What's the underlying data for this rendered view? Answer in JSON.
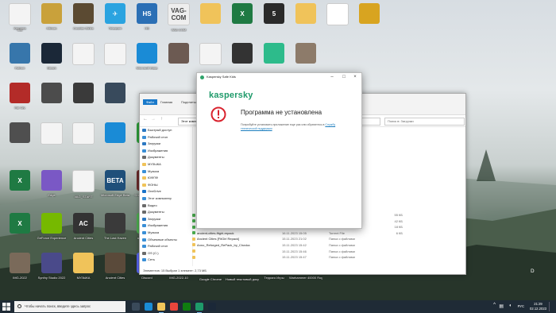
{
  "desktop": {
    "icons": [
      {
        "label": "Корзина",
        "color": "#8fb2d8",
        "glyph": "♻"
      },
      {
        "label": "Hitman",
        "color": "#c9a13b",
        "glyph": ""
      },
      {
        "label": "Counter-Strike",
        "color": "#5b4a32",
        "glyph": ""
      },
      {
        "label": "Telegram",
        "color": "#2aa3e0",
        "glyph": "✈"
      },
      {
        "label": "HS",
        "color": "#2b6fb5",
        "glyph": "HS"
      },
      {
        "label": "VAG-COM",
        "color": "#eeeeee",
        "glyph": "VAG-COM"
      },
      {
        "label": "",
        "color": "#f0c35a",
        "glyph": ""
      },
      {
        "label": "",
        "color": "#1f7a43",
        "glyph": "X"
      },
      {
        "label": "",
        "color": "#2a2a2a",
        "glyph": "5"
      },
      {
        "label": "",
        "color": "#f0c35a",
        "glyph": ""
      },
      {
        "label": "",
        "color": "#ffffff",
        "glyph": ""
      },
      {
        "label": "",
        "color": "#d8a420",
        "glyph": ""
      },
      {
        "label": "Python",
        "color": "#3776ab",
        "glyph": ""
      },
      {
        "label": "Steam",
        "color": "#1b2838",
        "glyph": ""
      },
      {
        "label": "",
        "color": "#f4f4f4",
        "glyph": ""
      },
      {
        "label": "",
        "color": "#f4f4f4",
        "glyph": ""
      },
      {
        "label": "Microsoft Edge",
        "color": "#1a8bd6",
        "glyph": ""
      },
      {
        "label": "",
        "color": "#6c5a52",
        "glyph": ""
      },
      {
        "label": "",
        "color": "#f4f4f4",
        "glyph": ""
      },
      {
        "label": "",
        "color": "#333",
        "glyph": ""
      },
      {
        "label": "",
        "color": "#2dbb8b",
        "glyph": ""
      },
      {
        "label": "",
        "color": "#8d7b6a",
        "glyph": ""
      },
      {
        "label": "Far Cry",
        "color": "#b32b28",
        "glyph": ""
      },
      {
        "label": "",
        "color": "#4c4c4c",
        "glyph": ""
      },
      {
        "label": "",
        "color": "#3a3a3a",
        "glyph": ""
      },
      {
        "label": "",
        "color": "#384a5c",
        "glyph": ""
      },
      {
        "label": "",
        "color": "#4f4f4f",
        "glyph": ""
      },
      {
        "label": "",
        "color": "#f4f4f4",
        "glyph": ""
      },
      {
        "label": "",
        "color": "#f4f4f4",
        "glyph": ""
      },
      {
        "label": "",
        "color": "#1a8bd6",
        "glyph": ""
      },
      {
        "label": "FTP",
        "color": "#2e9e3a",
        "glyph": "FTP"
      },
      {
        "label": "",
        "color": "#1f7a43",
        "glyph": "X"
      },
      {
        "label": "Edge",
        "color": "#7a58c5",
        "glyph": ""
      },
      {
        "label": "VAG_START",
        "color": "#f4f4f4",
        "glyph": ""
      },
      {
        "label": "Microsoft Edge Beta",
        "color": "#1f4f7a",
        "glyph": "BETA"
      },
      {
        "label": "Crusader Kings II",
        "color": "#6b2b2b",
        "glyph": ""
      },
      {
        "label": "",
        "color": "#1f7a43",
        "glyph": "X"
      },
      {
        "label": "GeForce Experience",
        "color": "#76b900",
        "glyph": ""
      },
      {
        "label": "Ancient Cities",
        "color": "#333",
        "glyph": "AC"
      },
      {
        "label": "The Last Haven",
        "color": "#3a3a3a",
        "glyph": ""
      },
      {
        "label": "uTorrent Web",
        "color": "#4caf50",
        "glyph": "µ"
      },
      {
        "label": "IMG-2022",
        "color": "#7a6a5a",
        "glyph": ""
      },
      {
        "label": "Synthy Studio 2022",
        "color": "#4a4a8a",
        "glyph": ""
      },
      {
        "label": "МУЗЫКА",
        "color": "#f0c35a",
        "glyph": ""
      },
      {
        "label": "Ancient Cities",
        "color": "#5a4a3a",
        "glyph": ""
      },
      {
        "label": "Discord",
        "color": "#5865f2",
        "glyph": ""
      },
      {
        "label": "IMG-2022-10",
        "color": "#444",
        "glyph": ""
      },
      {
        "label": "Google Chrome",
        "color": "#f4f4f4",
        "glyph": ""
      },
      {
        "label": "Новый текстовый документ",
        "color": "#f4f4f4",
        "glyph": ""
      },
      {
        "label": "Терраго Игры",
        "color": "#2ecc71",
        "glyph": ""
      },
      {
        "label": "Warhammer 40000 Rogue Trader",
        "color": "#333",
        "glyph": ""
      },
      {
        "label": "осу",
        "color": "#f4f4f4",
        "glyph": ""
      }
    ]
  },
  "explorer": {
    "tabs": [
      "Файл",
      "Главная",
      "Поделиться",
      "Вид"
    ],
    "address": "Этот компьютер > Загрузки",
    "search_placeholder": "Поиск в: Загрузки",
    "nav": [
      {
        "label": "Быстрый доступ",
        "color": "#2b78c2"
      },
      {
        "label": "Рабочий стол",
        "color": "#3a8fd6"
      },
      {
        "label": "Загрузки",
        "color": "#2b78c2"
      },
      {
        "label": "Изображения",
        "color": "#3a8fd6"
      },
      {
        "label": "Документы",
        "color": "#6a6a6a"
      },
      {
        "label": "МУЗЫКА",
        "color": "#f0c35a"
      },
      {
        "label": "Музыка",
        "color": "#3a8fd6"
      },
      {
        "label": "ЮФПФ",
        "color": "#f0c35a"
      },
      {
        "label": "ФОНЫ",
        "color": "#f0c35a"
      },
      {
        "label": "OneDrive",
        "color": "#1a73c9"
      },
      {
        "label": "Этот компьютер",
        "color": "#3a8fd6"
      },
      {
        "label": "Видео",
        "color": "#6a6a6a"
      },
      {
        "label": "Документы",
        "color": "#6a6a6a"
      },
      {
        "label": "Загрузки",
        "color": "#2b78c2"
      },
      {
        "label": "Изображения",
        "color": "#3a8fd6"
      },
      {
        "label": "Музыка",
        "color": "#3a8fd6"
      },
      {
        "label": "Объемные объекты",
        "color": "#3a8fd6"
      },
      {
        "label": "Рабочий стол",
        "color": "#3a8fd6"
      },
      {
        "label": "OS (C:)",
        "color": "#6a6a6a"
      },
      {
        "label": "Сеть",
        "color": "#3a8fd6"
      }
    ],
    "files": [
      {
        "name": "total-war-rome-ii-emperor-edition-2_4_0...",
        "date": "20.11.2023 11:59",
        "type": "Torrent File",
        "size": "55 КБ",
        "color": "#4caf50"
      },
      {
        "name": "Anno_Reforged_RePack_by_Chovka",
        "date": "17.11.2023 15:42",
        "type": "Torrent File",
        "size": "42 КБ",
        "color": "#4caf50"
      },
      {
        "name": "ancient_civilization_v0_8_8_SEKRI",
        "date": "17.11.2023 16:01",
        "type": "Torrent File",
        "size": "18 КБ",
        "color": "#4caf50"
      },
      {
        "name": "ancient-cities-fitgirl-repack",
        "date": "16.11.2023 15:05",
        "type": "Torrent File",
        "size": "6 КБ",
        "color": "#4caf50"
      },
      {
        "name": "Ancient Cities [FitGirl Repack]",
        "date": "15.11.2023 21:02",
        "type": "Папка с файлами",
        "size": "",
        "color": "#f0c35a"
      },
      {
        "name": "Anno_Reforged_RePack_by_Chovka",
        "date": "15.11.2023 15:42",
        "type": "Папка с файлами",
        "size": "",
        "color": "#f0c35a"
      },
      {
        "name": "",
        "date": "15.11.2023 15:46",
        "type": "Папка с файлами",
        "size": "",
        "color": "#f0c35a"
      },
      {
        "name": "",
        "date": "15.11.2023 15:47",
        "type": "Папка с файлами",
        "size": "",
        "color": "#f0c35a"
      }
    ],
    "status": "Элементов: 15     Выбран 1 элемент: 2,73 МБ"
  },
  "kaspersky": {
    "window_title": "Kaspersky Safe Kids",
    "logo": "kaspersky",
    "heading": "Программа не установлена",
    "message": "Попробуйте установить приложение еще раз или обратитесь в",
    "link": "Службу технической поддержки",
    "brand_color": "#1e9a6a",
    "error_color": "#d9232e"
  },
  "taskbar": {
    "search_placeholder": "Чтобы начать поиск, введите здесь запрос",
    "apps": [
      {
        "name": "task-view",
        "color": "#3a4a5a"
      },
      {
        "name": "edge",
        "color": "#1a8bd6"
      },
      {
        "name": "explorer",
        "color": "#f0c35a"
      },
      {
        "name": "chrome",
        "color": "#e8453c"
      },
      {
        "name": "xbox",
        "color": "#107c10"
      },
      {
        "name": "kaspersky",
        "color": "#1e9a6a"
      },
      {
        "name": "steam",
        "color": "#1b2838"
      }
    ],
    "lang": "РУС",
    "time": "21:29",
    "date": "02.12.2023"
  }
}
